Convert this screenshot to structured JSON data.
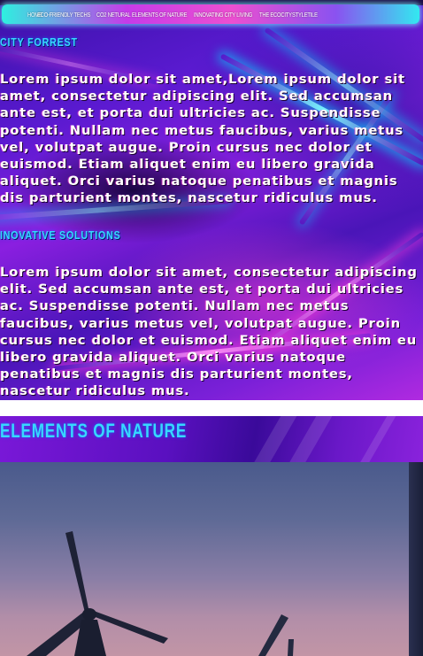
{
  "nav": {
    "items": [
      "HOME",
      "ECO-FRIENDLY TECHS",
      "CO2 NETURAL",
      "ELEMENTS OF NATURE",
      "INNOVATING CITY LIVING",
      "THE ECOCITY",
      "STYLETILE"
    ]
  },
  "sections": {
    "city_forrest": {
      "title": "CITY FORREST",
      "body": "Lorem ipsum dolor sit amet,Lorem ipsum dolor sit amet, consectetur adipiscing elit. Sed accumsan ante est, et porta dui ultricies ac. Suspendisse potenti. Nullam nec metus faucibus, varius metus vel, volutpat augue. Proin cursus nec dolor et euismod. Etiam aliquet enim eu libero gravida aliquet. Orci varius natoque penatibus et magnis dis parturient montes, nascetur ridiculus mus."
    },
    "innovative": {
      "title": "INOVATIVE SOLUTIONS",
      "body": "Lorem ipsum dolor sit amet, consectetur adipiscing elit. Sed accumsan ante est, et porta dui ultricies ac. Suspendisse potenti. Nullam nec metus faucibus, varius metus vel, volutpat augue. Proin cursus nec dolor et euismod. Etiam aliquet enim eu libero gravida aliquet. Orci varius natoque penatibus et magnis dis parturient montes, nascetur ridiculus mus."
    },
    "nature": {
      "title": "ELEMENTS OF NATURE"
    }
  },
  "colors": {
    "accent": "#37d8ff",
    "background": "#5a1ad0",
    "nav_glow": "#2ef0e0"
  }
}
